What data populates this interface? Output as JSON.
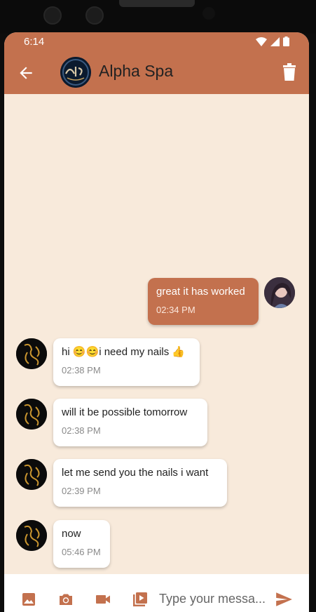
{
  "status_bar": {
    "time": "6:14"
  },
  "header": {
    "title": "Alpha Spa"
  },
  "messages": [
    {
      "direction": "out",
      "text": "great it has worked",
      "time": "02:34 PM"
    },
    {
      "direction": "in",
      "text": "hi 😊😊i need my nails 👍",
      "time": "02:38 PM"
    },
    {
      "direction": "in",
      "text": "will it be possible tomorrow",
      "time": "02:38 PM"
    },
    {
      "direction": "in",
      "text": "let me send you the nails i want",
      "time": "02:39 PM"
    },
    {
      "direction": "in",
      "text": "now",
      "time": "05:46 PM"
    }
  ],
  "composer": {
    "placeholder": "Type your messa..."
  },
  "colors": {
    "accent": "#c3714e",
    "background": "#f8eadb",
    "bubble_in": "#ffffff"
  },
  "icons": [
    "back-arrow-icon",
    "trash-icon",
    "image-icon",
    "camera-icon",
    "video-icon",
    "video-library-icon",
    "send-icon"
  ]
}
